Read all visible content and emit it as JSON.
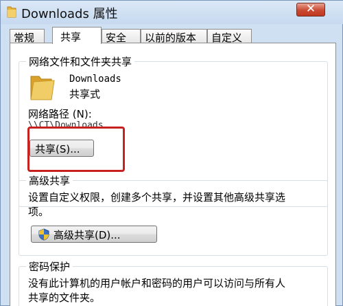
{
  "window": {
    "title": "Downloads 属性",
    "close_label": "✕"
  },
  "tabs": [
    {
      "label": "常规",
      "active": false
    },
    {
      "label": "共享",
      "active": true
    },
    {
      "label": "安全",
      "active": false
    },
    {
      "label": "以前的版本",
      "active": false
    },
    {
      "label": "自定义",
      "active": false
    }
  ],
  "network_sharing": {
    "group_title": "网络文件和文件夹共享",
    "folder_name": "Downloads",
    "share_status": "共享式",
    "path_label": "网络路径 (N):",
    "path_value": "\\\\CT\\Downloads",
    "share_button": "共享(S)..."
  },
  "advanced_sharing": {
    "group_title": "高级共享",
    "description_line1": "设置自定义权限，创建多个共享，并设置其他高级共享选",
    "description_line2": "项。",
    "button": "高级共享(D)..."
  },
  "password_protection": {
    "group_title": "密码保护",
    "description_line1": "没有此计算机的用户帐户和密码的用户可以访问与所有人",
    "description_line2": "共享的文件夹。"
  },
  "colors": {
    "highlight": "#c8201e",
    "title_bar": "#cfe0f3",
    "close_button": "#c94a33"
  }
}
